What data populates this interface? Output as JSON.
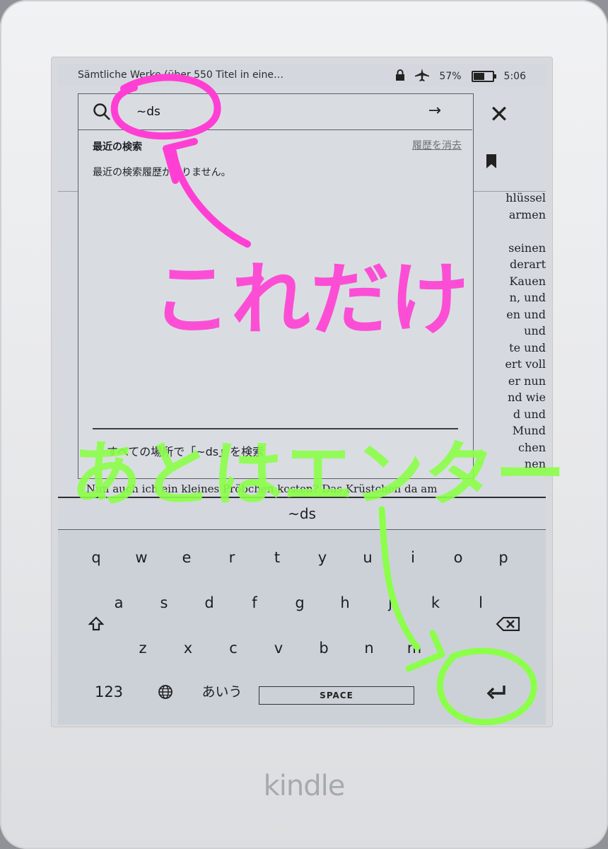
{
  "status": {
    "book_title": "Sämtliche Werke (über 550 Titel in eine…",
    "battery_percent": "57%",
    "battery_level": 0.57,
    "time": "5:06"
  },
  "search": {
    "query": "~ds",
    "recent_label": "最近の検索",
    "clear_history": "履歴を消去",
    "no_recent": "最近の検索履歴がありません。",
    "search_everywhere": "すべての場所で「~ds」を検索"
  },
  "reader": {
    "right_column": [
      "hlüssel",
      "armen",
      "",
      "seinen",
      "derart",
      "Kauen",
      "n, und",
      "en und",
      "und",
      "te und",
      "ert voll",
      "er nun",
      "nd wie",
      "d und",
      "Mund",
      "chen",
      "nen"
    ],
    "bottom_line": "Nun auch ich ein kleines Pröbchen kosten? Das Krüstchen da am"
  },
  "keyboard": {
    "preview": "~ds",
    "row1": [
      "q",
      "w",
      "e",
      "r",
      "t",
      "y",
      "u",
      "i",
      "o",
      "p"
    ],
    "row2": [
      "a",
      "s",
      "d",
      "f",
      "g",
      "h",
      "j",
      "k",
      "l"
    ],
    "row3": [
      "z",
      "x",
      "c",
      "v",
      "b",
      "n",
      "m"
    ],
    "numbers_key": "123",
    "kana_key": "あいう",
    "space_label": "SPACE"
  },
  "annotations": {
    "pink_text": "これだけ",
    "green_text": "あとはエンター",
    "pink_color": "#ff3fd4",
    "green_color": "#8cff4a"
  },
  "device": {
    "logo": "kindle"
  }
}
